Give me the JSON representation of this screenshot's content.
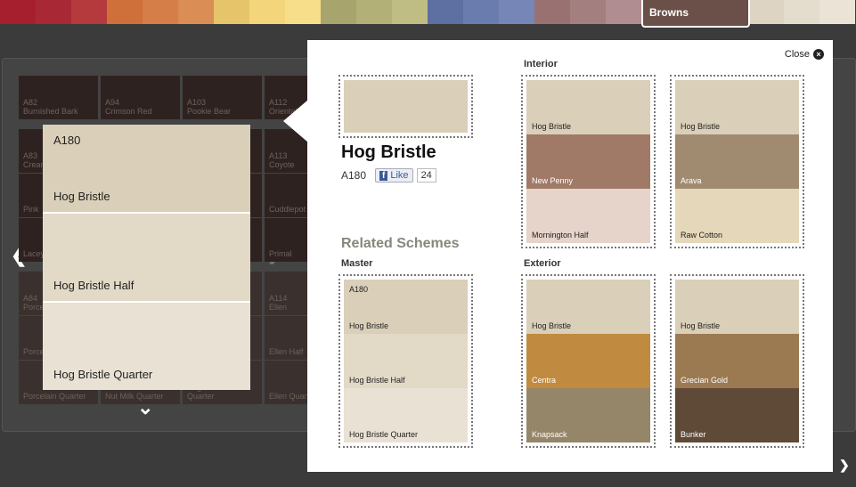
{
  "palette_strip": {
    "colors": [
      "#a51f2e",
      "#a82835",
      "#b43a3e",
      "#cf6f3a",
      "#d57e47",
      "#db8d56",
      "#e6c56a",
      "#f3d57c",
      "#f6de8b",
      "#a8a46e",
      "#b3b077",
      "#c0bd84",
      "#5e6fa2",
      "#6a7cad",
      "#7686b6",
      "#9a7171",
      "#a47f80",
      "#b08d90"
    ],
    "tail_colors": [
      "#ddd4c4",
      "#e4ddcd",
      "#ebe4d6"
    ],
    "active_tab": "Browns"
  },
  "background_grid": [
    {
      "code": "A82",
      "name": "Burnished Bark"
    },
    {
      "code": "A94",
      "name": "Crimson Red"
    },
    {
      "code": "A103",
      "name": "Pookie Bear"
    },
    {
      "code": "A112",
      "name": "Oriental"
    },
    {
      "code": "A83",
      "name": "Cream"
    },
    {
      "code": "",
      "name": ""
    },
    {
      "code": "",
      "name": ""
    },
    {
      "code": "A113",
      "name": "Coyote"
    },
    {
      "code": "",
      "name": "Pink"
    },
    {
      "code": "",
      "name": ""
    },
    {
      "code": "",
      "name": ""
    },
    {
      "code": "",
      "name": "Cuddlepot"
    },
    {
      "code": "",
      "name": "Lacey"
    },
    {
      "code": "",
      "name": ""
    },
    {
      "code": "",
      "name": ""
    },
    {
      "code": "",
      "name": "Primal"
    },
    {
      "code": "A84",
      "name": "Porce"
    },
    {
      "code": "",
      "name": ""
    },
    {
      "code": "",
      "name": ""
    },
    {
      "code": "A114",
      "name": "Ellen"
    },
    {
      "code": "",
      "name": "Porce"
    },
    {
      "code": "",
      "name": ""
    },
    {
      "code": "",
      "name": ""
    },
    {
      "code": "",
      "name": "Ellen Half"
    },
    {
      "code": "",
      "name": "Porcelain Quarter"
    },
    {
      "code": "",
      "name": "Nut Milk Quarter"
    },
    {
      "code": "",
      "name": "Angels Face Quarter"
    },
    {
      "code": "",
      "name": "Ellen Quarter"
    }
  ],
  "hover_card": {
    "code": "A180",
    "items": [
      {
        "name": "Hog Bristle",
        "color": "#dacfb8"
      },
      {
        "name": "Hog Bristle Half",
        "color": "#e2d9c6"
      },
      {
        "name": "Hog Bristle Quarter",
        "color": "#e9e2d4"
      }
    ]
  },
  "popup": {
    "close_label": "Close",
    "swatch_color": "#dacfb8",
    "title": "Hog Bristle",
    "code": "A180",
    "like_label": "Like",
    "like_count": "24",
    "related_heading": "Related Schemes",
    "master_label": "Master",
    "interior_label": "Interior",
    "exterior_label": "Exterior",
    "master": [
      {
        "code": "A180",
        "name": "Hog Bristle",
        "color": "#dacfb8"
      },
      {
        "name": "Hog Bristle Half",
        "color": "#e2d9c6"
      },
      {
        "name": "Hog Bristle Quarter",
        "color": "#e9e2d4"
      }
    ],
    "interior": [
      [
        {
          "name": "Hog Bristle",
          "color": "#dacfb8"
        },
        {
          "name": "New Penny",
          "color": "#a07a66",
          "light": true
        },
        {
          "name": "Mornington Half",
          "color": "#e6d3c9"
        }
      ],
      [
        {
          "name": "Hog Bristle",
          "color": "#dacfb8"
        },
        {
          "name": "Arava",
          "color": "#a08b71",
          "light": true
        },
        {
          "name": "Raw Cotton",
          "color": "#e5d7b9"
        }
      ]
    ],
    "exterior": [
      [
        {
          "name": "Hog Bristle",
          "color": "#dacfb8"
        },
        {
          "name": "Centra",
          "color": "#c08b40",
          "light": true
        },
        {
          "name": "Knapsack",
          "color": "#968669",
          "light": true
        }
      ],
      [
        {
          "name": "Hog Bristle",
          "color": "#dacfb8"
        },
        {
          "name": "Grecian Gold",
          "color": "#9b7a52",
          "light": true
        },
        {
          "name": "Bunker",
          "color": "#5f4a38",
          "light": true
        }
      ]
    ]
  }
}
